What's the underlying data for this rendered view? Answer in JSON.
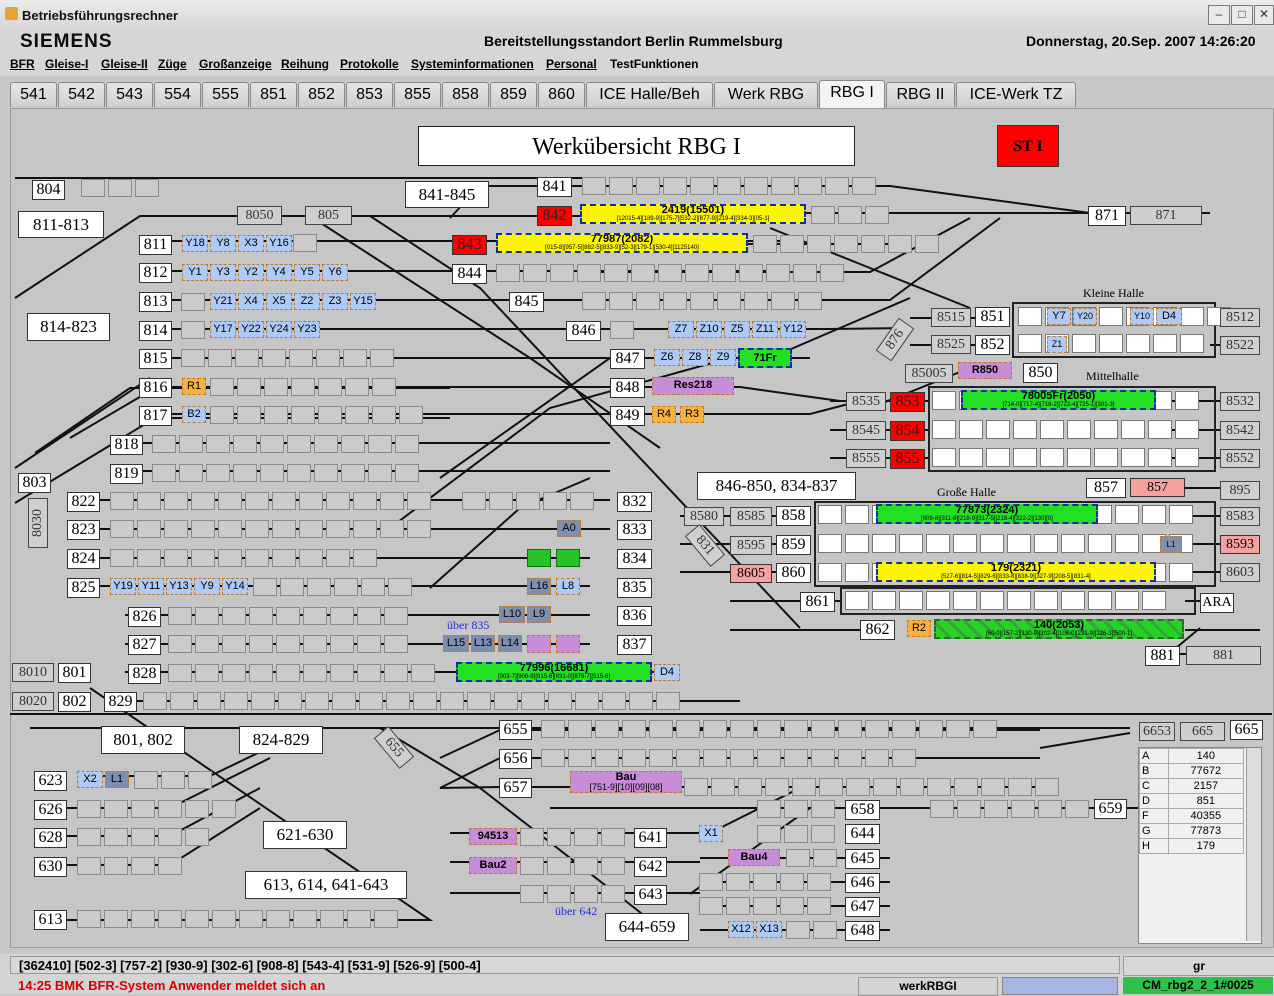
{
  "window": {
    "title": "Betriebsführungsrechner"
  },
  "header": {
    "brand": "SIEMENS",
    "location": "Bereitstellungsstandort Berlin Rummelsburg",
    "datetime": "Donnerstag, 20.Sep. 2007  14:26:20"
  },
  "menu": [
    "BFR",
    "Gleise-I",
    "Gleise-II",
    "Züge",
    "Großanzeige",
    "Reihung",
    "Protokolle",
    "Systeminformationen",
    "Personal",
    "TestFunktionen"
  ],
  "tabs": [
    "541",
    "542",
    "543",
    "554",
    "555",
    "851",
    "852",
    "853",
    "855",
    "858",
    "859",
    "860",
    "ICE Halle/Beh",
    "Werk RBG",
    "RBG I",
    "RBG II",
    "ICE-Werk TZ"
  ],
  "active_tab": "RBG I",
  "view": {
    "title": "Werkübersicht RBG I",
    "st_button": "ST I"
  },
  "groups": {
    "g811": "811-813",
    "g814": "814-823",
    "g841": "841-845",
    "g846": "846-850, 834-837",
    "g801": "801, 802",
    "g824": "824-829",
    "g621": "621-630",
    "g613": "613, 614, 641-643",
    "g644": "644-659"
  },
  "halls": {
    "kleine": "Kleine Halle",
    "mittel": "Mittelhalle",
    "gross": "Große Halle"
  },
  "notes": {
    "ueber835": "über 835",
    "ueber642": "über 642"
  },
  "tracks": {
    "t804": "804",
    "t811": "811",
    "t812": "812",
    "t813": "813",
    "t814": "814",
    "t815": "815",
    "t816": "816",
    "t817": "817",
    "t818": "818",
    "t819": "819",
    "t803": "803",
    "t822": "822",
    "t823": "823",
    "t824": "824",
    "t825": "825",
    "t826": "826",
    "t827": "827",
    "t828": "828",
    "t829": "829",
    "t801": "801",
    "t802": "802",
    "t841": "841",
    "t842": "842",
    "t843": "843",
    "t844": "844",
    "t845": "845",
    "t846": "846",
    "t847": "847",
    "t848": "848",
    "t849": "849",
    "t832": "832",
    "t833": "833",
    "t834": "834",
    "t835": "835",
    "t836": "836",
    "t837": "837",
    "t871": "871",
    "t851": "851",
    "t852": "852",
    "t850": "850",
    "t853": "853",
    "t854": "854",
    "t855": "855",
    "t857": "857",
    "t858": "858",
    "t859": "859",
    "t860": "860",
    "t861": "861",
    "t862": "862",
    "t881": "881",
    "t655": "655",
    "t656": "656",
    "t657": "657",
    "t658": "658",
    "t659": "659",
    "t665": "665",
    "t623": "623",
    "t626": "626",
    "t628": "628",
    "t630": "630",
    "t613": "613",
    "t641": "641",
    "t642": "642",
    "t643": "643",
    "t644": "644",
    "t645": "645",
    "t646": "646",
    "t647": "647",
    "t648": "648"
  },
  "signals": {
    "s8050": "8050",
    "s805": "805",
    "s871": "871",
    "s8515": "8515",
    "s8525": "8525",
    "s85005": "85005",
    "s8535": "8535",
    "s8545": "8545",
    "s8555": "8555",
    "s8512": "8512",
    "s8522": "8522",
    "s8532": "8532",
    "s8542": "8542",
    "s8552": "8552",
    "s857b": "857",
    "s895": "895",
    "s8580": "8580",
    "s8585": "8585",
    "s8595": "8595",
    "s8605": "8605",
    "s8583": "8583",
    "s8593": "8593",
    "s8603": "8603",
    "sARA": "ARA",
    "s881": "881",
    "s8030": "8030",
    "s8010": "8010",
    "s8020": "8020",
    "s876": "876",
    "s831": "831",
    "s655d": "655",
    "s6653": "6653",
    "s665": "665"
  },
  "tags": {
    "y18": "Y18",
    "y8": "Y8",
    "x3": "X3",
    "y16": "Y16",
    "y1": "Y1",
    "y3": "Y3",
    "y2": "Y2",
    "y4": "Y4",
    "y5": "Y5",
    "y6": "Y6",
    "y21": "Y21",
    "x4": "X4",
    "x5": "X5",
    "z2": "Z2",
    "z3": "Z3",
    "y15": "Y15",
    "y17": "Y17",
    "y22": "Y22",
    "y24": "Y24",
    "y23": "Y23",
    "r1": "R1",
    "b2": "B2",
    "y19": "Y19",
    "y11": "Y11",
    "y13": "Y13",
    "y9": "Y9",
    "y14": "Y14",
    "a0": "A0",
    "l16": "L16",
    "l8": "L8",
    "l10": "L10",
    "l9": "L9",
    "l15": "L15",
    "l13": "L13",
    "l14": "L14",
    "z7": "Z7",
    "z10": "Z10",
    "z5": "Z5",
    "z11": "Z11",
    "y12": "Y12",
    "z6": "Z6",
    "z8": "Z8",
    "z9": "Z9",
    "res218": "Res218",
    "r4": "R4",
    "r3": "R3",
    "r850": "R850",
    "y7": "Y7",
    "y20": "Y20",
    "y10": "Y10",
    "d4a": "D4",
    "z1": "Z1",
    "l1": "L1",
    "r2": "R2",
    "d4b": "D4",
    "x2": "X2",
    "l1b": "L1",
    "bau": "Bau",
    "bau_sub": "[751-9][10][09][08]",
    "t94513": "94513",
    "bau2": "Bau2",
    "x1": "X1",
    "bau4": "Bau4",
    "x12": "X12",
    "x13": "X13"
  },
  "trains": {
    "tr2419": "2419(15501)",
    "tr2419_sub": "[12015-4][189-9][175-7][532-2][877-9][219-4][334-3][05-1]",
    "tr77987": "77987(2082)",
    "tr77987_sub": "[015-8][957-5][882-5][833-9][52-3][179-1][530-4][1125140]",
    "tr71fr": "71Fr",
    "tr78005": "78005Fr(2050)",
    "tr78005_sub": "[714-0][717-4][718-2][722-4][725-1][301-3]",
    "tr77873": "77873(2324)",
    "tr77873_sub": "[609-8][311-8][218-9][317-5][218-4][322-2][130][0]",
    "tr179": "179(2321)",
    "tr179_sub": "[527-6][814-5][829-6][833-8][838-9][327-9][208-5][831-4]",
    "tr140": "140(2053)",
    "tr140_sub": "[60-0][157-2][130-9][302-4][106-0][231-9][126-3][500-1]",
    "tr77996": "77996(16681)",
    "tr77996_sub": "[003-7][906-9][915-8][831-0][879-7][515-8]"
  },
  "legend": [
    [
      "A",
      "140"
    ],
    [
      "B",
      "77672"
    ],
    [
      "C",
      "2157"
    ],
    [
      "D",
      "851"
    ],
    [
      "F",
      "40355"
    ],
    [
      "G",
      "77873"
    ],
    [
      "H",
      "179"
    ]
  ],
  "status": {
    "routes": "[362410]  [502-3]  [757-2]  [930-9]  [302-6]  [908-8]  [543-4]  [531-9]  [526-9]  [500-4]",
    "gr": "gr",
    "message": "14:25 BMK BFR-System Anwender meldet sich an",
    "station": "werkRBGI",
    "connection": "CM_rbg2_2_1#0025"
  },
  "colors": {
    "occupied": "#ff0000",
    "train_yellow": "#fbf500",
    "train_green": "#24e024",
    "tag_blue": "#aecbf7",
    "tag_orange": "#f6b23a",
    "tag_violet": "#c88dd8"
  }
}
